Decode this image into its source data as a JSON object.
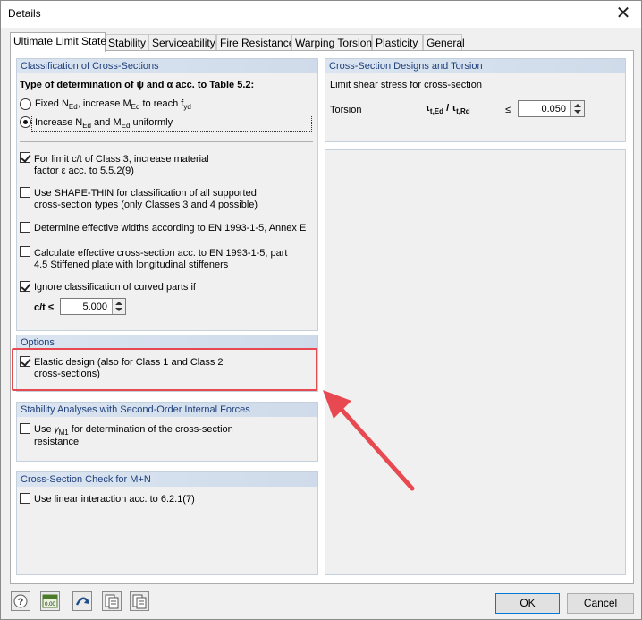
{
  "window": {
    "title": "Details"
  },
  "tabs": [
    "Ultimate Limit State",
    "Stability",
    "Serviceability",
    "Fire Resistance",
    "Warping Torsion",
    "Plasticity",
    "General"
  ],
  "classification": {
    "header": "Classification of Cross-Sections",
    "type_label": "Type of determination of ψ and α acc. to Table 5.2:",
    "radio1": "Fixed N",
    "radio1_sub1": "Ed",
    "radio1_mid": ", increase M",
    "radio1_sub2": "Ed",
    "radio1_end": " to reach f",
    "radio1_sub3": "yd",
    "radio2": "Increase N",
    "radio2_sub1": "Ed",
    "radio2_mid": " and M",
    "radio2_sub2": "Ed",
    "radio2_end": " uniformly",
    "check1_line1": "For limit c/t of Class 3, increase material",
    "check1_line2": "factor ε acc. to 5.5.2(9)",
    "check2_line1": "Use SHAPE-THIN for classification of all supported",
    "check2_line2": "cross-section types (only Classes 3 and 4 possible)",
    "check3": "Determine effective widths according to EN 1993-1-5, Annex E",
    "check4_line1": "Calculate effective cross-section acc. to EN 1993-1-5, part",
    "check4_line2": "4.5 Stiffened plate with longitudinal stiffeners",
    "check5": "Ignore classification of curved parts if",
    "ct_label": "c/t ≤",
    "ct_value": "5.000"
  },
  "options": {
    "header": "Options",
    "check_line1": "Elastic design (also for Class 1 and Class 2",
    "check_line2": "cross-sections)"
  },
  "stability": {
    "header": "Stability Analyses with Second-Order Internal Forces",
    "check_pre": "Use ",
    "check_gamma": "γ",
    "check_gamma_sub": "M1",
    "check_post": " for determination of the cross-section",
    "check_line2": "resistance"
  },
  "mn": {
    "header": "Cross-Section Check for M+N",
    "check": "Use linear interaction acc. to 6.2.1(7)"
  },
  "torsion": {
    "header": "Cross-Section Designs and Torsion",
    "limit_label": "Limit shear stress for cross-section",
    "torsion_label": "Torsion",
    "tau1": "τ",
    "tau1_sub": "t,Ed",
    "slash": " / ",
    "tau2": "τ",
    "tau2_sub": "t,Rd",
    "leq": "≤",
    "value": "0.050"
  },
  "buttons": {
    "ok": "OK",
    "cancel": "Cancel"
  }
}
